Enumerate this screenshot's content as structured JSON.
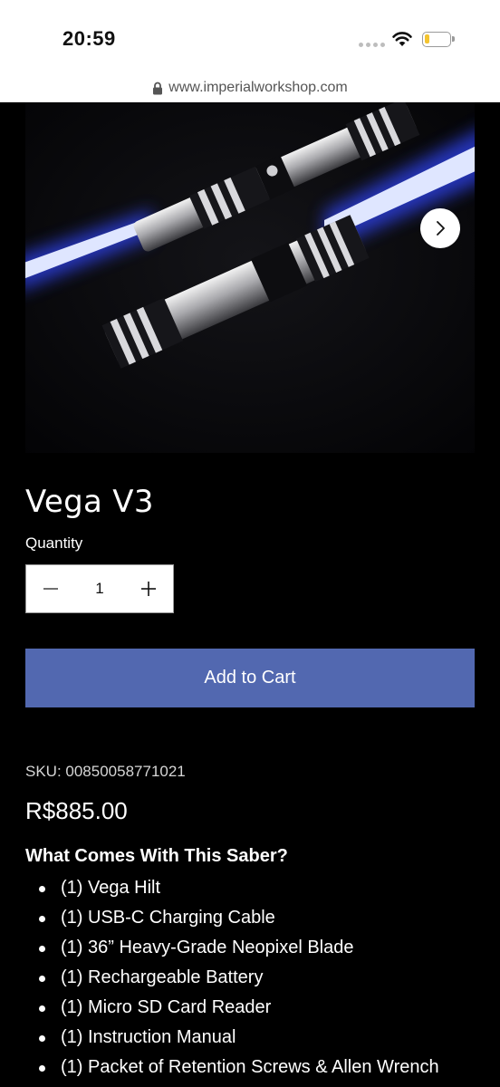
{
  "status_bar": {
    "time": "20:59",
    "battery_level": 0.15,
    "battery_color": "#f4c430"
  },
  "browser": {
    "url": "www.imperialworkshop.com",
    "lock_icon": "lock-icon"
  },
  "gallery": {
    "next_icon": "chevron-right-icon",
    "image_subject": "two-lightsabers"
  },
  "product": {
    "title": "Vega V3",
    "quantity_label": "Quantity",
    "quantity_value": "1",
    "add_to_cart_label": "Add to Cart",
    "sku": "SKU: 00850058771021",
    "price": "R$885.00"
  },
  "includes": {
    "title": "What Comes With This Saber?",
    "items": [
      "(1) Vega Hilt",
      "(1) USB-C Charging Cable",
      "(1) 36” Heavy-Grade Neopixel Blade",
      "(1) Rechargeable Battery",
      "(1) Micro SD Card Reader",
      "(1) Instruction Manual",
      "(1) Packet of Retention Screws & Allen Wrench"
    ]
  },
  "colors": {
    "accent": "#5268b0",
    "background": "#000000",
    "blade_glow": "#4a5cff"
  }
}
